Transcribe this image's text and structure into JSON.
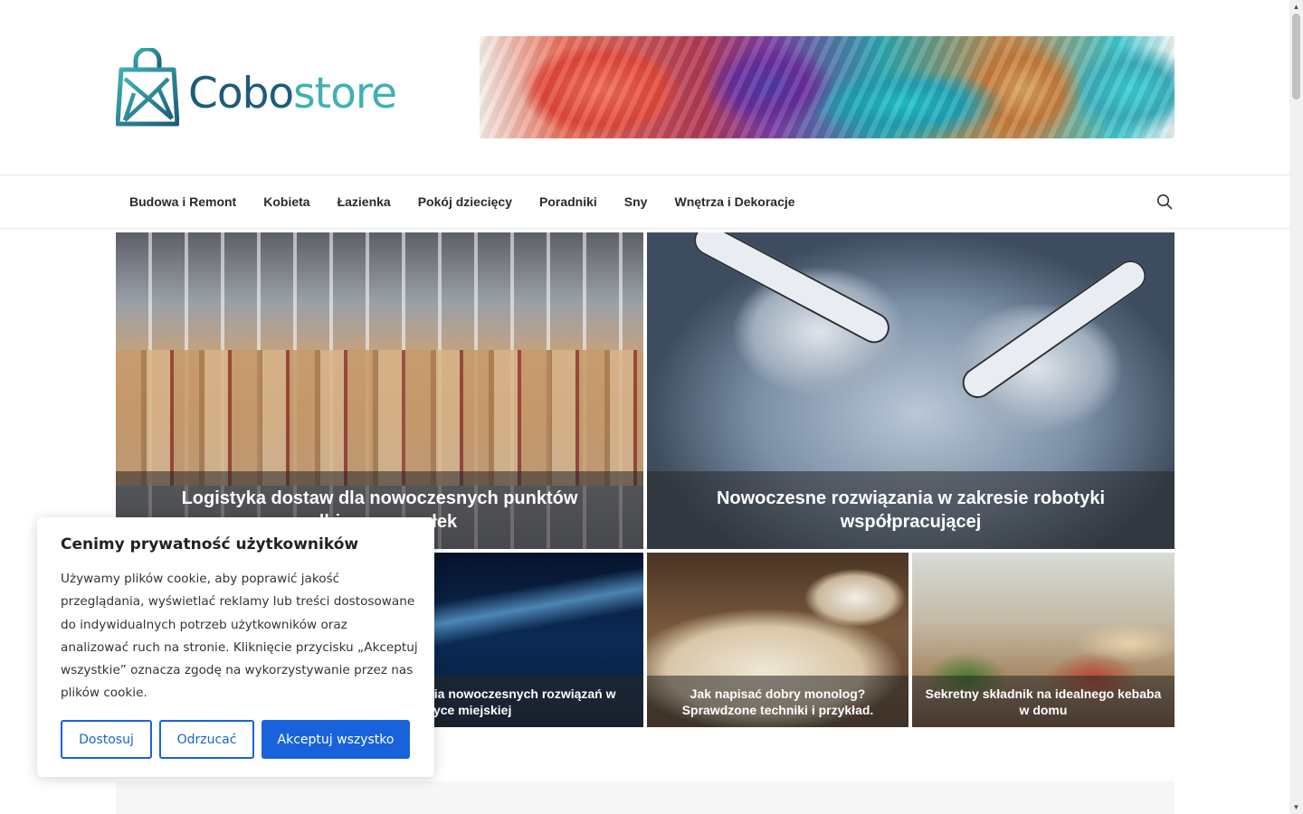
{
  "brand": {
    "name_part1": "Cobo",
    "name_part2": "store",
    "color_dark": "#1d5c7a",
    "color_light": "#3fb1b3"
  },
  "nav": {
    "items": [
      {
        "label": "Budowa i Remont"
      },
      {
        "label": "Kobieta"
      },
      {
        "label": "Łazienka"
      },
      {
        "label": "Pokój dziecięcy"
      },
      {
        "label": "Poradniki"
      },
      {
        "label": "Sny"
      },
      {
        "label": "Wnętrza i Dekoracje"
      }
    ],
    "search_icon": "search-icon"
  },
  "featured": {
    "big": [
      {
        "title": "Logistyka dostaw dla nowoczesnych punktów odbioru przesyłek"
      },
      {
        "title": "Nowoczesne rozwiązania w zakresie robotyki współpracującej"
      }
    ],
    "small": [
      {
        "title": "Przykłady wykorzystania nowoczesnych rozwiązań w logistyce miejskiej"
      },
      {
        "title": "Jak napisać dobry monolog? Sprawdzone techniki i przykład."
      },
      {
        "title": "Sekretny składnik na idealnego kebaba w domu"
      }
    ]
  },
  "cookie": {
    "title": "Cenimy prywatność użytkowników",
    "text": "Używamy plików cookie, aby poprawić jakość przeglądania, wyświetlać reklamy lub treści dostosowane do indywidualnych potrzeb użytkowników oraz analizować ruch na stronie. Kliknięcie przycisku „Akceptuj wszystkie” oznacza zgodę na wykorzystywanie przez nas plików cookie.",
    "customize_label": "Dostosuj",
    "reject_label": "Odrzucać",
    "accept_label": "Akceptuj wszystko",
    "accent_color": "#1863dc"
  }
}
